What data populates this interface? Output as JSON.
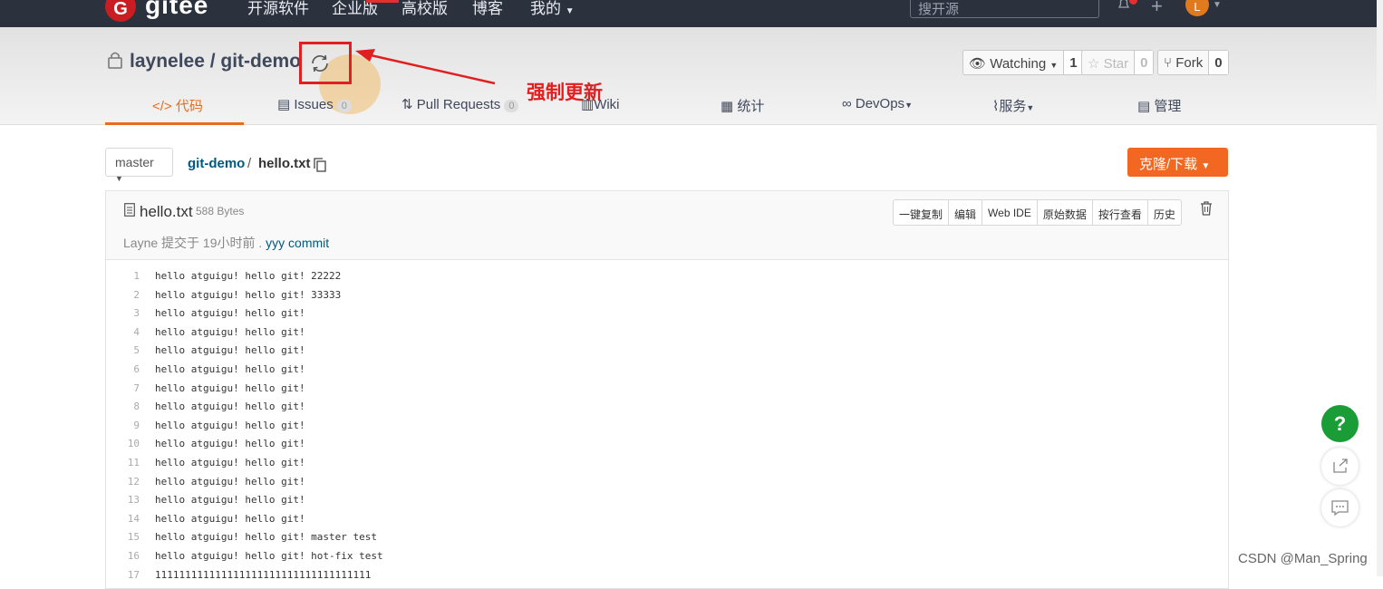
{
  "topbar": {
    "logo_letter": "G",
    "logo_text": "gitee",
    "nav": [
      "开源软件",
      "企业版",
      "高校版",
      "博客",
      "我的"
    ],
    "search_placeholder": "搜开源",
    "avatar_letter": "L"
  },
  "repo": {
    "title": "laynelee / git-demo",
    "annotation": "强制更新",
    "watch_label": "Watching",
    "watch_count": "1",
    "star_label": "Star",
    "star_count": "0",
    "fork_label": "Fork",
    "fork_count": "0"
  },
  "tabs": [
    {
      "label": "代码",
      "icon": "code-icon"
    },
    {
      "label": "Issues",
      "count": "0",
      "icon": "issues-icon"
    },
    {
      "label": "Pull Requests",
      "count": "0",
      "icon": "pull-request-icon"
    },
    {
      "label": "Wiki",
      "icon": "wiki-icon"
    },
    {
      "label": "统计",
      "icon": "stats-icon"
    },
    {
      "label": "DevOps",
      "icon": "devops-icon"
    },
    {
      "label": "服务",
      "icon": "service-icon"
    },
    {
      "label": "管理",
      "icon": "manage-icon"
    }
  ],
  "breadcrumb": {
    "branch": "master",
    "repo": "git-demo",
    "sep": "/",
    "file": "hello.txt"
  },
  "clone_label": "克隆/下载",
  "file": {
    "name": "hello.txt",
    "size": "588 Bytes",
    "commit_author": "Layne 提交于 19小时前 .",
    "commit_msg": "yyy commit",
    "actions": [
      "一键复制",
      "编辑",
      "Web IDE",
      "原始数据",
      "按行查看",
      "历史"
    ]
  },
  "code_lines": [
    "hello atguigu! hello git! 22222",
    "hello atguigu! hello git! 33333",
    "hello atguigu! hello git!",
    "hello atguigu! hello git!",
    "hello atguigu! hello git!",
    "hello atguigu! hello git!",
    "hello atguigu! hello git!",
    "hello atguigu! hello git!",
    "hello atguigu! hello git!",
    "hello atguigu! hello git!",
    "hello atguigu! hello git!",
    "hello atguigu! hello git!",
    "hello atguigu! hello git!",
    "hello atguigu! hello git!",
    "hello atguigu! hello git! master test",
    "hello atguigu! hello git! hot-fix test",
    "111111111111111111111111111111111111"
  ],
  "float": {
    "help": "?"
  },
  "watermark": "CSDN @Man_Spring",
  "colors": {
    "accent": "#f26822",
    "topbar": "#2b313d",
    "link": "#005980",
    "annotation": "#e02020"
  }
}
